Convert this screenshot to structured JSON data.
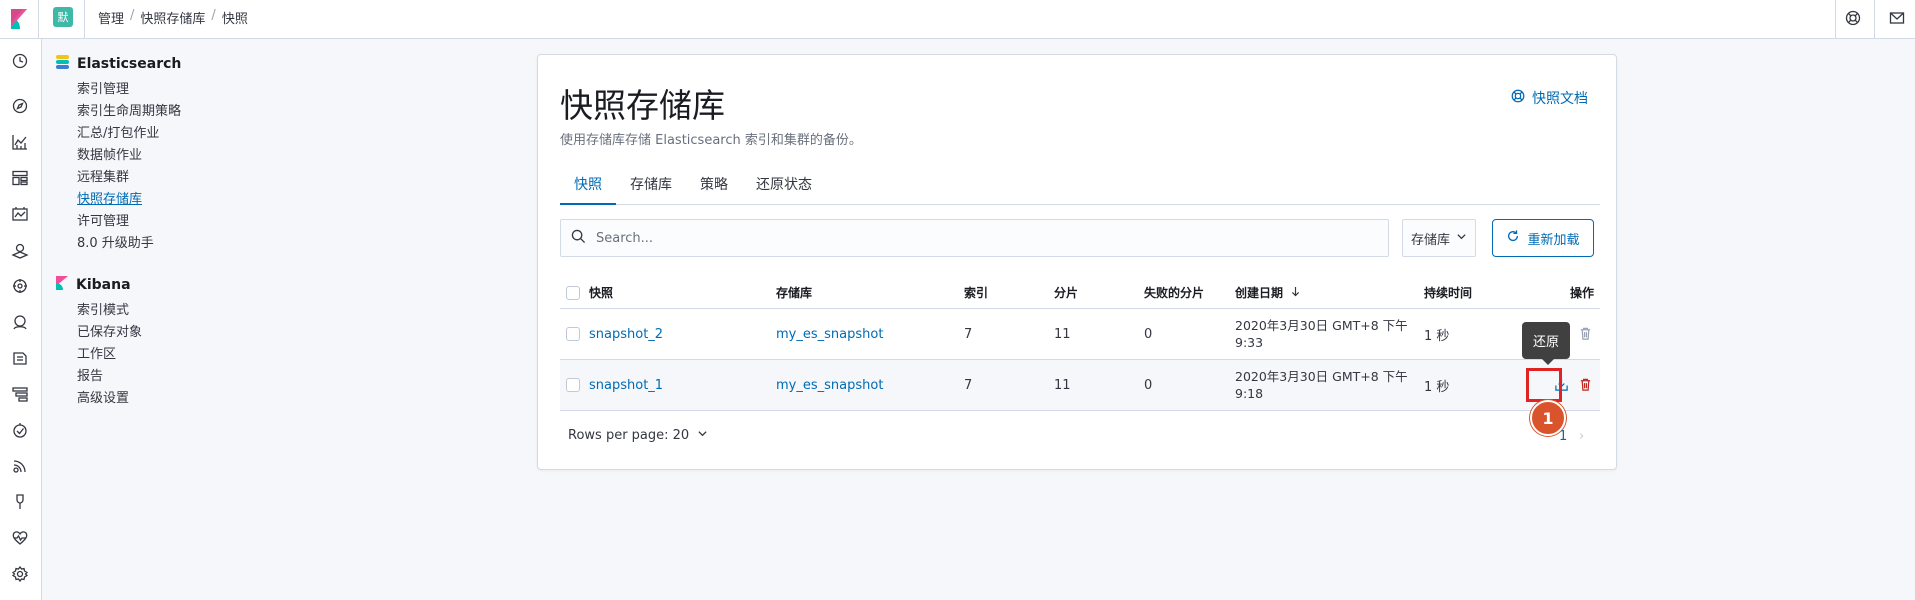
{
  "colors": {
    "accent": "#006bb4",
    "danger": "#bd271e",
    "avatar": "#3eb8a7",
    "callout": "#d9532c",
    "highlight": "#e02424"
  },
  "header": {
    "space_letter": "默",
    "breadcrumbs": [
      "管理",
      "快照存储库",
      "快照"
    ]
  },
  "leftnav": {
    "icons": [
      "clock-icon",
      "compass-icon",
      "visualize-icon",
      "dashboard-icon",
      "canvas-icon",
      "maps-icon",
      "ml-icon",
      "infra-icon",
      "logs-icon",
      "apm-icon",
      "uptime-icon",
      "siem-icon",
      "devtools-icon",
      "monitoring-icon",
      "management-icon"
    ]
  },
  "sidebar": {
    "elasticsearch": {
      "title": "Elasticsearch",
      "items": [
        "索引管理",
        "索引生命周期策略",
        "汇总/打包作业",
        "数据帧作业",
        "远程集群",
        "快照存储库",
        "许可管理",
        "8.0 升级助手"
      ]
    },
    "kibana": {
      "title": "Kibana",
      "items": [
        "索引模式",
        "已保存对象",
        "工作区",
        "报告",
        "高级设置"
      ]
    }
  },
  "panel": {
    "title": "快照存储库",
    "docs_link": "快照文档",
    "description": "使用存储库存储 Elasticsearch 索引和集群的备份。",
    "tabs": [
      "快照",
      "存储库",
      "策略",
      "还原状态"
    ],
    "search_placeholder": "Search...",
    "filter_label": "存储库",
    "reload_label": "重新加载",
    "columns": [
      "快照",
      "存储库",
      "索引",
      "分片",
      "失败的分片",
      "创建日期",
      "持续时间",
      "操作"
    ],
    "rows": [
      {
        "snapshot": "snapshot_2",
        "repository": "my_es_snapshot",
        "indices": "7",
        "shards": "11",
        "failed": "0",
        "date_line1": "2020年3月30日 GMT+8 下午",
        "date_line2": "9:33",
        "duration": "1 秒"
      },
      {
        "snapshot": "snapshot_1",
        "repository": "my_es_snapshot",
        "indices": "7",
        "shards": "11",
        "failed": "0",
        "date_line1": "2020年3月30日 GMT+8 下午",
        "date_line2": "9:18",
        "duration": "1 秒"
      }
    ],
    "rows_per_page": "Rows per page: 20",
    "page_number": "1",
    "page_next": "›"
  },
  "tooltip": "还原",
  "callout_number": "1"
}
